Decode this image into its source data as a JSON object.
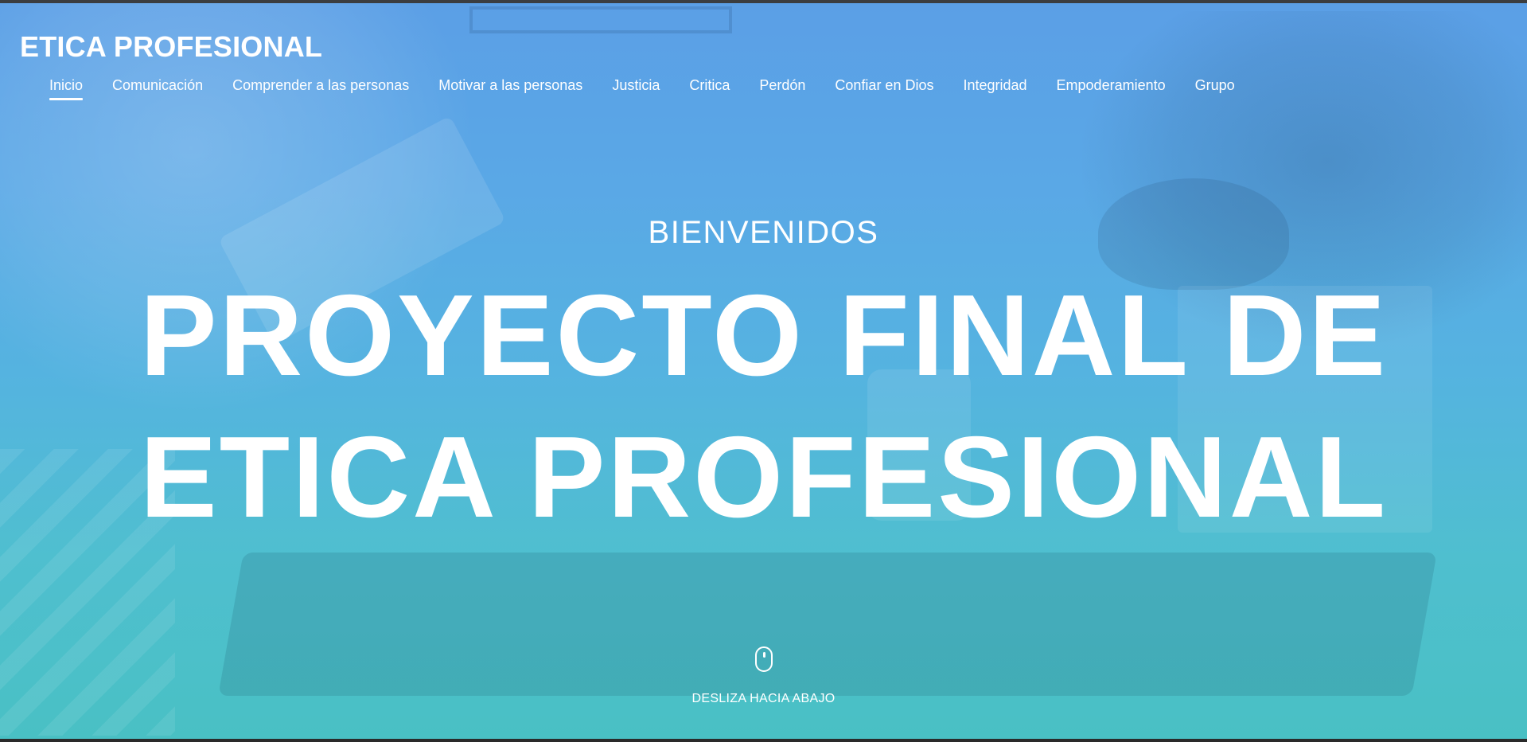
{
  "site": {
    "title": "ETICA PROFESIONAL"
  },
  "nav": {
    "active_index": 0,
    "items": [
      {
        "label": "Inicio"
      },
      {
        "label": "Comunicación"
      },
      {
        "label": "Comprender a las personas"
      },
      {
        "label": "Motivar a las personas"
      },
      {
        "label": "Justicia"
      },
      {
        "label": "Critica"
      },
      {
        "label": "Perdón"
      },
      {
        "label": "Confiar en Dios"
      },
      {
        "label": "Integridad"
      },
      {
        "label": "Empoderamiento"
      },
      {
        "label": "Grupo"
      }
    ]
  },
  "hero": {
    "welcome": "BIENVENIDOS",
    "headline_line1": "PROYECTO FINAL DE",
    "headline_line2": "ETICA PROFESIONAL",
    "scroll_icon": "mouse-icon",
    "scroll_label": "DESLIZA HACIA ABAJO"
  },
  "colors": {
    "overlay_top": "#5b9fe6",
    "overlay_bottom": "#49c0c4",
    "text": "#ffffff"
  }
}
